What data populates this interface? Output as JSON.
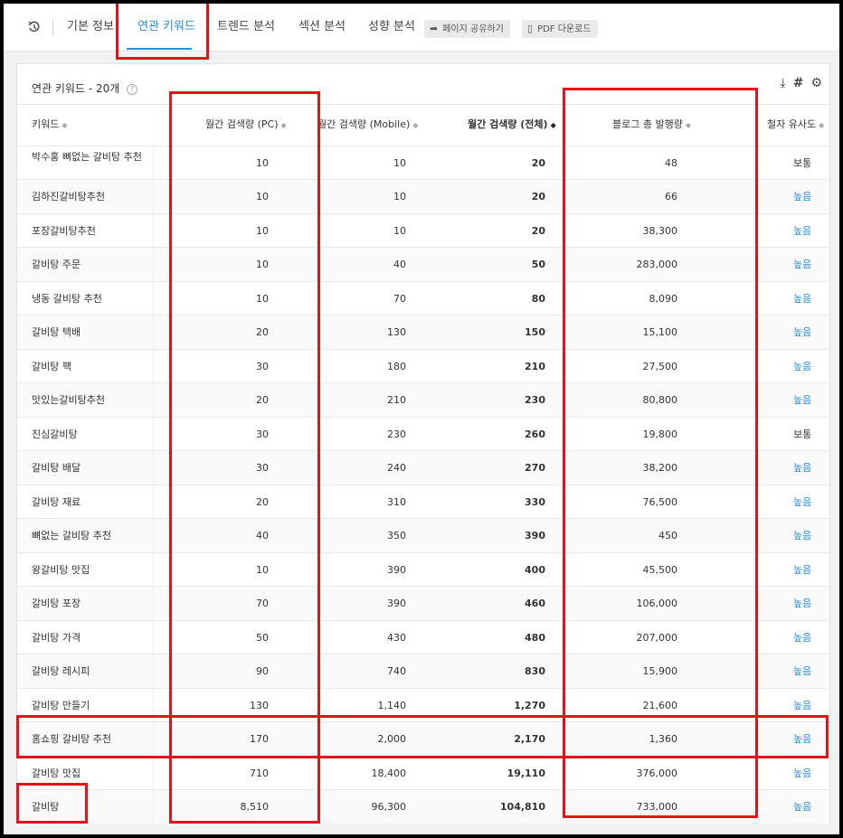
{
  "nav": {
    "tabs": [
      "기본 정보",
      "연관 키워드",
      "트렌드 분석",
      "섹션 분석",
      "성향 분석"
    ],
    "active_tab": 1,
    "share_label": "페이지 공유하기",
    "pdf_label": "PDF 다운로드"
  },
  "card": {
    "title": "연관 키워드 - 20개"
  },
  "table": {
    "headers": {
      "keyword": "키워드",
      "pc": "월간 검색량 (PC)",
      "mobile": "월간 검색량 (Mobile)",
      "total": "월간 검색량 (전체)",
      "blog": "블로그 총 발행량",
      "similarity": "철자 유사도"
    },
    "rows": [
      {
        "keyword": "박수홍 뼈없는 갈비탕 추천",
        "pc": "10",
        "mobile": "10",
        "total": "20",
        "blog": "48",
        "similarity": "보통"
      },
      {
        "keyword": "김하진갈비탕추천",
        "pc": "10",
        "mobile": "10",
        "total": "20",
        "blog": "66",
        "similarity": "높음"
      },
      {
        "keyword": "포장갈비탕추천",
        "pc": "10",
        "mobile": "10",
        "total": "20",
        "blog": "38,300",
        "similarity": "높음"
      },
      {
        "keyword": "갈비탕 주문",
        "pc": "10",
        "mobile": "40",
        "total": "50",
        "blog": "283,000",
        "similarity": "높음"
      },
      {
        "keyword": "냉동 갈비탕 추천",
        "pc": "10",
        "mobile": "70",
        "total": "80",
        "blog": "8,090",
        "similarity": "높음"
      },
      {
        "keyword": "갈비탕 택배",
        "pc": "20",
        "mobile": "130",
        "total": "150",
        "blog": "15,100",
        "similarity": "높음"
      },
      {
        "keyword": "갈비탕 팩",
        "pc": "30",
        "mobile": "180",
        "total": "210",
        "blog": "27,500",
        "similarity": "높음"
      },
      {
        "keyword": "맛있는갈비탕추천",
        "pc": "20",
        "mobile": "210",
        "total": "230",
        "blog": "80,800",
        "similarity": "높음"
      },
      {
        "keyword": "진심갈비탕",
        "pc": "30",
        "mobile": "230",
        "total": "260",
        "blog": "19,800",
        "similarity": "보통"
      },
      {
        "keyword": "갈비탕 배달",
        "pc": "30",
        "mobile": "240",
        "total": "270",
        "blog": "38,200",
        "similarity": "높음"
      },
      {
        "keyword": "갈비탕 재료",
        "pc": "20",
        "mobile": "310",
        "total": "330",
        "blog": "76,500",
        "similarity": "높음"
      },
      {
        "keyword": "뼈없는 갈비탕 추천",
        "pc": "40",
        "mobile": "350",
        "total": "390",
        "blog": "450",
        "similarity": "높음"
      },
      {
        "keyword": "왕갈비탕 맛집",
        "pc": "10",
        "mobile": "390",
        "total": "400",
        "blog": "45,500",
        "similarity": "높음"
      },
      {
        "keyword": "갈비탕 포장",
        "pc": "70",
        "mobile": "390",
        "total": "460",
        "blog": "106,000",
        "similarity": "높음"
      },
      {
        "keyword": "갈비탕 가격",
        "pc": "50",
        "mobile": "430",
        "total": "480",
        "blog": "207,000",
        "similarity": "높음"
      },
      {
        "keyword": "갈비탕 레시피",
        "pc": "90",
        "mobile": "740",
        "total": "830",
        "blog": "15,900",
        "similarity": "높음"
      },
      {
        "keyword": "갈비탕 만들기",
        "pc": "130",
        "mobile": "1,140",
        "total": "1,270",
        "blog": "21,600",
        "similarity": "높음"
      },
      {
        "keyword": "홈쇼핑 갈비탕 추천",
        "pc": "170",
        "mobile": "2,000",
        "total": "2,170",
        "blog": "1,360",
        "similarity": "높음"
      },
      {
        "keyword": "갈비탕 맛집",
        "pc": "710",
        "mobile": "18,400",
        "total": "19,110",
        "blog": "376,000",
        "similarity": "높음"
      },
      {
        "keyword": "갈비탕",
        "pc": "8,510",
        "mobile": "96,300",
        "total": "104,810",
        "blog": "733,000",
        "similarity": "높음"
      }
    ]
  },
  "colors": {
    "accent": "#2a8fd6",
    "highlight": "#e0141a"
  }
}
